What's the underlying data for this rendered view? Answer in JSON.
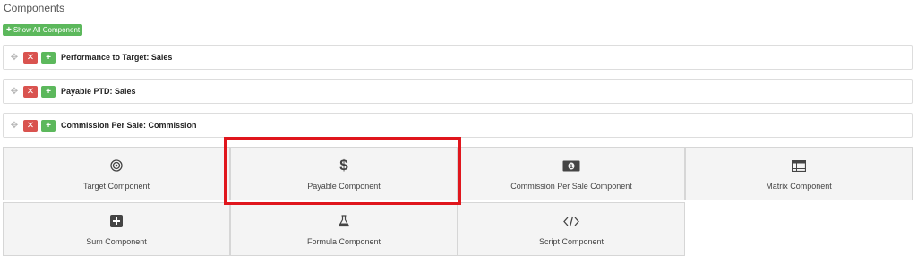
{
  "section_title": "Components",
  "show_all_label": "Show All Component",
  "rows": [
    {
      "label": "Performance to Target: Sales"
    },
    {
      "label": "Payable PTD: Sales"
    },
    {
      "label": "Commission Per Sale: Commission"
    }
  ],
  "tiles": [
    {
      "label": "Target Component",
      "icon": "target-icon"
    },
    {
      "label": "Payable Component",
      "icon": "dollar-icon"
    },
    {
      "label": "Commission Per Sale Component",
      "icon": "money-bill-icon"
    },
    {
      "label": "Matrix Component",
      "icon": "table-icon"
    },
    {
      "label": "Sum Component",
      "icon": "plus-square-icon"
    },
    {
      "label": "Formula Component",
      "icon": "flask-icon"
    },
    {
      "label": "Script Component",
      "icon": "code-icon"
    }
  ],
  "highlight_color": "#e0161d",
  "colors": {
    "success": "#5cb85c",
    "danger": "#d9534f"
  }
}
